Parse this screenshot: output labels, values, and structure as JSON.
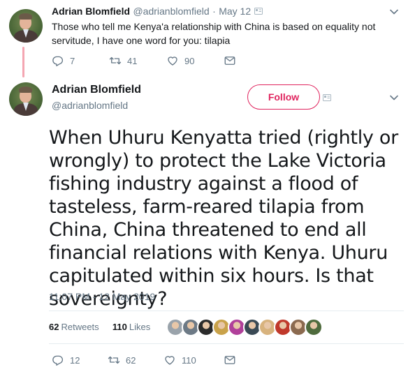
{
  "quoted_tweet": {
    "name": "Adrian Blomfield",
    "handle": "@adrianblomfield",
    "separator": "·",
    "date": "May 12",
    "text": "Those who tell me Kenya'a relationship with China is based on equality not servitude, I have one word for you: tilapia",
    "reply_count": "7",
    "retweet_count": "41",
    "like_count": "90"
  },
  "main_tweet": {
    "name": "Adrian Blomfield",
    "handle": "@adrianblomfield",
    "follow_label": "Follow",
    "text": "When Uhuru Kenyatta tried (rightly or wrongly) to protect the Lake Victoria fishing industry against a flood of tasteless, farm-reared tilapia from China, China threatened to end all financial relations with Kenya. Uhuru capitulated within six hours. Is that sovereignty?",
    "timestamp": "11:07 PM - 12 May 2019",
    "retweets_count": "62",
    "retweets_label": "Retweets",
    "likes_count": "110",
    "likes_label": "Likes",
    "reply_count": "12",
    "retweet_count": "62",
    "like_count": "110"
  },
  "likers": [
    {
      "name": "liker-1",
      "color": "#9aa3ab"
    },
    {
      "name": "liker-2",
      "color": "#6d7a86"
    },
    {
      "name": "liker-3",
      "color": "#2b2b2b"
    },
    {
      "name": "liker-4",
      "color": "#c9a24a"
    },
    {
      "name": "liker-5",
      "color": "#b0409a"
    },
    {
      "name": "liker-6",
      "color": "#3a4a55"
    },
    {
      "name": "liker-7",
      "color": "#d8b37e"
    },
    {
      "name": "liker-8",
      "color": "#c0392b"
    },
    {
      "name": "liker-9",
      "color": "#8b6a4f"
    },
    {
      "name": "liker-10",
      "color": "#4f6b3d"
    }
  ],
  "colors": {
    "accent": "#e0245e",
    "muted": "#657786",
    "text": "#14171a",
    "thread_line": "#f4a6b2"
  }
}
